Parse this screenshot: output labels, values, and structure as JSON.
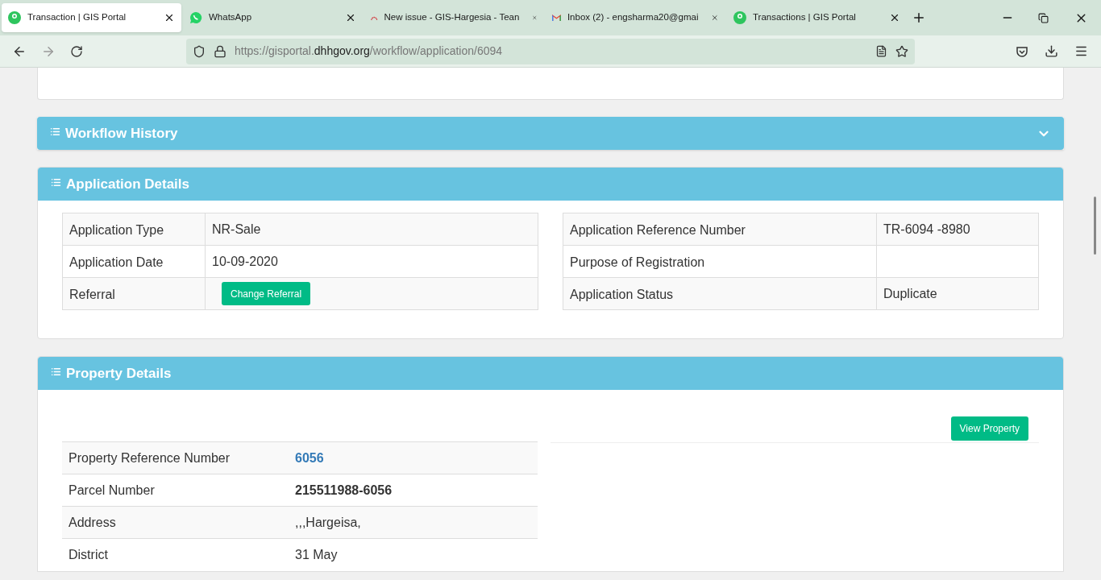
{
  "browser": {
    "tabs": [
      {
        "title": "Transaction | GIS Portal",
        "kind": "portal",
        "selected": true
      },
      {
        "title": "WhatsApp",
        "kind": "chat",
        "selected": false
      },
      {
        "title": "New issue - GIS-Hargesia - Tean",
        "kind": "arc",
        "selected": false
      },
      {
        "title": "Inbox (2) - engsharma20@gmai",
        "kind": "mail",
        "selected": false
      },
      {
        "title": "Transactions | GIS Portal",
        "kind": "portal",
        "selected": false
      }
    ],
    "url": {
      "prefix": "https://gisportal.",
      "domain": "dhhgov.org",
      "path": "/workflow/application/6094"
    }
  },
  "sections": [
    {
      "title": "Workflow History",
      "expanded": false
    },
    {
      "title": "Application Details",
      "expanded": true
    },
    {
      "title": "Property Details",
      "expanded": true
    }
  ],
  "application_details": {
    "left": [
      {
        "label": "Application Type",
        "value": "NR-Sale"
      },
      {
        "label": "Application Date",
        "value": "10-09-2020"
      },
      {
        "label": "Referral",
        "button": "Change Referral"
      }
    ],
    "right": [
      {
        "label": "Application Reference Number",
        "value": "TR-6094 -8980"
      },
      {
        "label": "Purpose of Registration"
      },
      {
        "label": "Application Status",
        "value": "Duplicate"
      }
    ]
  },
  "property_details": {
    "button": "View Property",
    "rows": [
      {
        "label": "Property Reference Number",
        "value": "6056",
        "kind": "link"
      },
      {
        "label": "Parcel Number",
        "value": "215511988-6056",
        "kind": "bold"
      },
      {
        "label": "Address",
        "value": ",,,Hargeisa,",
        "kind": "plain"
      },
      {
        "label": "District",
        "value": "31 May",
        "kind": "plain"
      }
    ]
  }
}
